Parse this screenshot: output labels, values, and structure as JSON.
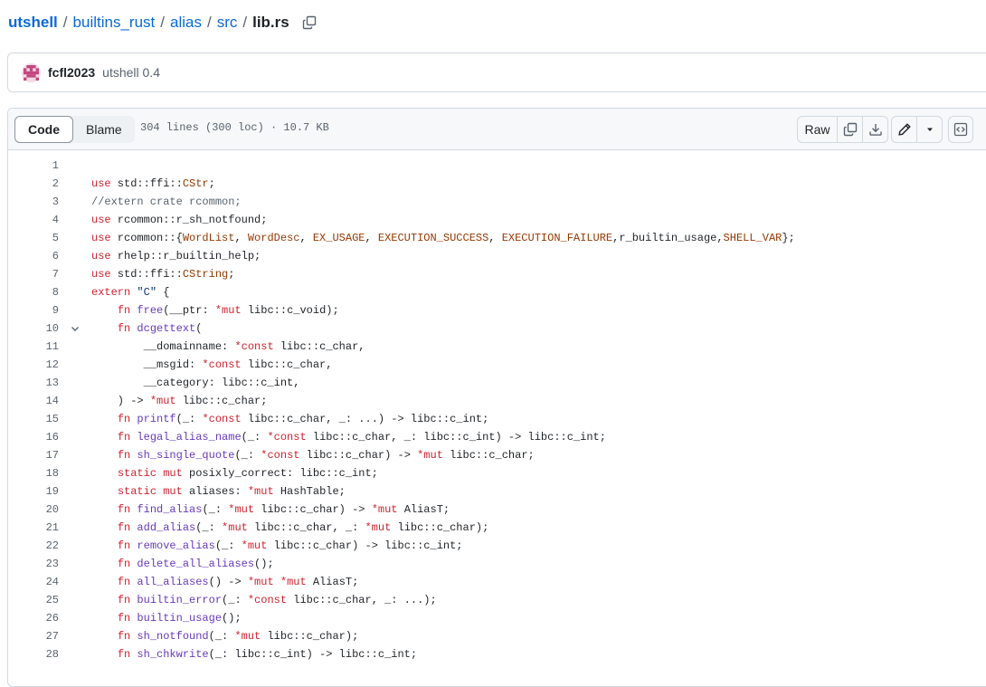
{
  "breadcrumb": {
    "root": "utshell",
    "parts": [
      "builtins_rust",
      "alias",
      "src"
    ],
    "file": "lib.rs",
    "separator": "/"
  },
  "commit": {
    "author": "fcfl2023",
    "message": "utshell 0.4"
  },
  "file_header": {
    "code_tab": "Code",
    "blame_tab": "Blame",
    "info": "304 lines (300 loc) · 10.7 KB",
    "raw_label": "Raw"
  },
  "icons": {
    "copy_path": "copy-icon",
    "copy_raw": "copy-icon",
    "download": "download-icon",
    "edit": "pencil-icon",
    "edit_menu": "triangle-down-icon",
    "symbols": "code-square-icon",
    "fold": "chevron-down-icon"
  },
  "colors": {
    "link": "#0969da",
    "keyword": "#cf222e",
    "function": "#6639ba",
    "type": "#953800",
    "string": "#0a3069",
    "comment": "#59636e"
  },
  "code_lines": [
    {
      "n": "1",
      "tokens": []
    },
    {
      "n": "2",
      "tokens": [
        [
          "k",
          "use"
        ],
        [
          "p",
          " std::ffi::"
        ],
        [
          "t",
          "CStr"
        ],
        [
          "p",
          ";"
        ]
      ]
    },
    {
      "n": "3",
      "tokens": [
        [
          "c",
          "//extern crate rcommon;"
        ]
      ]
    },
    {
      "n": "4",
      "tokens": [
        [
          "k",
          "use"
        ],
        [
          "p",
          " rcommon::r_sh_notfound;"
        ]
      ]
    },
    {
      "n": "5",
      "tokens": [
        [
          "k",
          "use"
        ],
        [
          "p",
          " rcommon::{"
        ],
        [
          "t",
          "WordList"
        ],
        [
          "p",
          ", "
        ],
        [
          "t",
          "WordDesc"
        ],
        [
          "p",
          ", "
        ],
        [
          "t",
          "EX_USAGE"
        ],
        [
          "p",
          ", "
        ],
        [
          "t",
          "EXECUTION_SUCCESS"
        ],
        [
          "p",
          ", "
        ],
        [
          "t",
          "EXECUTION_FAILURE"
        ],
        [
          "p",
          ",r_builtin_usage,"
        ],
        [
          "t",
          "SHELL_VAR"
        ],
        [
          "p",
          "};"
        ]
      ]
    },
    {
      "n": "6",
      "tokens": [
        [
          "k",
          "use"
        ],
        [
          "p",
          " rhelp::r_builtin_help;"
        ]
      ]
    },
    {
      "n": "7",
      "tokens": [
        [
          "k",
          "use"
        ],
        [
          "p",
          " std::ffi::"
        ],
        [
          "t",
          "CString"
        ],
        [
          "p",
          ";"
        ]
      ]
    },
    {
      "n": "8",
      "tokens": [
        [
          "k",
          "extern"
        ],
        [
          "p",
          " "
        ],
        [
          "s",
          "\"C\""
        ],
        [
          "p",
          " {"
        ]
      ]
    },
    {
      "n": "9",
      "tokens": [
        [
          "p",
          "    "
        ],
        [
          "k",
          "fn"
        ],
        [
          "p",
          " "
        ],
        [
          "f",
          "free"
        ],
        [
          "p",
          "(__ptr: "
        ],
        [
          "k",
          "*mut"
        ],
        [
          "p",
          " libc::c_void);"
        ]
      ]
    },
    {
      "n": "10",
      "fold": true,
      "tokens": [
        [
          "p",
          "    "
        ],
        [
          "k",
          "fn"
        ],
        [
          "p",
          " "
        ],
        [
          "f",
          "dcgettext"
        ],
        [
          "p",
          "("
        ]
      ]
    },
    {
      "n": "11",
      "tokens": [
        [
          "p",
          "        __domainname: "
        ],
        [
          "k",
          "*const"
        ],
        [
          "p",
          " libc::c_char,"
        ]
      ]
    },
    {
      "n": "12",
      "tokens": [
        [
          "p",
          "        __msgid: "
        ],
        [
          "k",
          "*const"
        ],
        [
          "p",
          " libc::c_char,"
        ]
      ]
    },
    {
      "n": "13",
      "tokens": [
        [
          "p",
          "        __category: libc::c_int,"
        ]
      ]
    },
    {
      "n": "14",
      "tokens": [
        [
          "p",
          "    ) -> "
        ],
        [
          "k",
          "*mut"
        ],
        [
          "p",
          " libc::c_char;"
        ]
      ]
    },
    {
      "n": "15",
      "tokens": [
        [
          "p",
          "    "
        ],
        [
          "k",
          "fn"
        ],
        [
          "p",
          " "
        ],
        [
          "f",
          "printf"
        ],
        [
          "p",
          "(_: "
        ],
        [
          "k",
          "*const"
        ],
        [
          "p",
          " libc::c_char, _: ...) -> libc::c_int;"
        ]
      ]
    },
    {
      "n": "16",
      "tokens": [
        [
          "p",
          "    "
        ],
        [
          "k",
          "fn"
        ],
        [
          "p",
          " "
        ],
        [
          "f",
          "legal_alias_name"
        ],
        [
          "p",
          "(_: "
        ],
        [
          "k",
          "*const"
        ],
        [
          "p",
          " libc::c_char, _: libc::c_int) -> libc::c_int;"
        ]
      ]
    },
    {
      "n": "17",
      "tokens": [
        [
          "p",
          "    "
        ],
        [
          "k",
          "fn"
        ],
        [
          "p",
          " "
        ],
        [
          "f",
          "sh_single_quote"
        ],
        [
          "p",
          "(_: "
        ],
        [
          "k",
          "*const"
        ],
        [
          "p",
          " libc::c_char) -> "
        ],
        [
          "k",
          "*mut"
        ],
        [
          "p",
          " libc::c_char;"
        ]
      ]
    },
    {
      "n": "18",
      "tokens": [
        [
          "p",
          "    "
        ],
        [
          "k",
          "static mut"
        ],
        [
          "p",
          " posixly_correct: libc::c_int;"
        ]
      ]
    },
    {
      "n": "19",
      "tokens": [
        [
          "p",
          "    "
        ],
        [
          "k",
          "static mut"
        ],
        [
          "p",
          " aliases: "
        ],
        [
          "k",
          "*mut"
        ],
        [
          "p",
          " HashTable;"
        ]
      ]
    },
    {
      "n": "20",
      "tokens": [
        [
          "p",
          "    "
        ],
        [
          "k",
          "fn"
        ],
        [
          "p",
          " "
        ],
        [
          "f",
          "find_alias"
        ],
        [
          "p",
          "(_: "
        ],
        [
          "k",
          "*mut"
        ],
        [
          "p",
          " libc::c_char) -> "
        ],
        [
          "k",
          "*mut"
        ],
        [
          "p",
          " AliasT;"
        ]
      ]
    },
    {
      "n": "21",
      "tokens": [
        [
          "p",
          "    "
        ],
        [
          "k",
          "fn"
        ],
        [
          "p",
          " "
        ],
        [
          "f",
          "add_alias"
        ],
        [
          "p",
          "(_: "
        ],
        [
          "k",
          "*mut"
        ],
        [
          "p",
          " libc::c_char, _: "
        ],
        [
          "k",
          "*mut"
        ],
        [
          "p",
          " libc::c_char);"
        ]
      ]
    },
    {
      "n": "22",
      "tokens": [
        [
          "p",
          "    "
        ],
        [
          "k",
          "fn"
        ],
        [
          "p",
          " "
        ],
        [
          "f",
          "remove_alias"
        ],
        [
          "p",
          "(_: "
        ],
        [
          "k",
          "*mut"
        ],
        [
          "p",
          " libc::c_char) -> libc::c_int;"
        ]
      ]
    },
    {
      "n": "23",
      "tokens": [
        [
          "p",
          "    "
        ],
        [
          "k",
          "fn"
        ],
        [
          "p",
          " "
        ],
        [
          "f",
          "delete_all_aliases"
        ],
        [
          "p",
          "();"
        ]
      ]
    },
    {
      "n": "24",
      "tokens": [
        [
          "p",
          "    "
        ],
        [
          "k",
          "fn"
        ],
        [
          "p",
          " "
        ],
        [
          "f",
          "all_aliases"
        ],
        [
          "p",
          "() -> "
        ],
        [
          "k",
          "*mut"
        ],
        [
          "p",
          " "
        ],
        [
          "k",
          "*mut"
        ],
        [
          "p",
          " AliasT;"
        ]
      ]
    },
    {
      "n": "25",
      "tokens": [
        [
          "p",
          "    "
        ],
        [
          "k",
          "fn"
        ],
        [
          "p",
          " "
        ],
        [
          "f",
          "builtin_error"
        ],
        [
          "p",
          "(_: "
        ],
        [
          "k",
          "*const"
        ],
        [
          "p",
          " libc::c_char, _: ...);"
        ]
      ]
    },
    {
      "n": "26",
      "tokens": [
        [
          "p",
          "    "
        ],
        [
          "k",
          "fn"
        ],
        [
          "p",
          " "
        ],
        [
          "f",
          "builtin_usage"
        ],
        [
          "p",
          "();"
        ]
      ]
    },
    {
      "n": "27",
      "tokens": [
        [
          "p",
          "    "
        ],
        [
          "k",
          "fn"
        ],
        [
          "p",
          " "
        ],
        [
          "f",
          "sh_notfound"
        ],
        [
          "p",
          "(_: "
        ],
        [
          "k",
          "*mut"
        ],
        [
          "p",
          " libc::c_char);"
        ]
      ]
    },
    {
      "n": "28",
      "tokens": [
        [
          "p",
          "    "
        ],
        [
          "k",
          "fn"
        ],
        [
          "p",
          " "
        ],
        [
          "f",
          "sh_chkwrite"
        ],
        [
          "p",
          "(_: libc::c_int) -> libc::c_int;"
        ]
      ]
    }
  ]
}
